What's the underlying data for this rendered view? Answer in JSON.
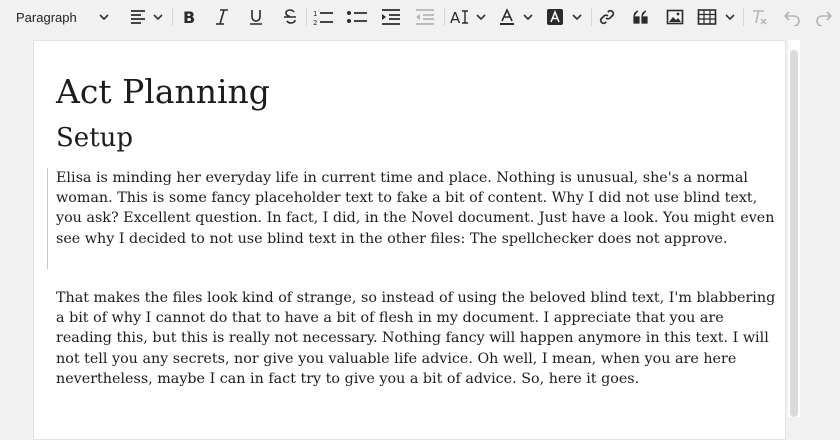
{
  "toolbar": {
    "paragraph_style": "Paragraph",
    "buttons": [
      {
        "name": "align-icon"
      },
      {
        "name": "bold-icon"
      },
      {
        "name": "italic-icon"
      },
      {
        "name": "underline-icon"
      },
      {
        "name": "strikethrough-icon"
      },
      {
        "name": "numbered-list-icon"
      },
      {
        "name": "bulleted-list-icon"
      },
      {
        "name": "indent-icon"
      },
      {
        "name": "outdent-icon"
      },
      {
        "name": "font-size-icon"
      },
      {
        "name": "font-color-icon"
      },
      {
        "name": "highlight-icon"
      },
      {
        "name": "link-icon"
      },
      {
        "name": "blockquote-icon"
      },
      {
        "name": "image-icon"
      },
      {
        "name": "table-icon"
      },
      {
        "name": "clear-format-icon"
      },
      {
        "name": "undo-icon"
      },
      {
        "name": "redo-icon"
      }
    ]
  },
  "document": {
    "title": "Act Planning",
    "heading": "Setup",
    "paragraphs": [
      "Elisa is minding her everyday life in current time and place. Nothing is unusual, she's a normal woman. This is some fancy placeholder text to fake a bit of content. Why I did not use blind text, you ask? Excellent question. In fact, I did, in the Novel document. Just have a look. You might even see why I decided to not use blind text in the other files: The spellchecker does not approve.",
      "That makes the files look kind of strange, so instead of using the beloved blind text, I'm blabbering a bit of why I cannot do that to have a bit of flesh in my document. I appreciate that you are reading this, but this is really not necessary. Nothing fancy will happen anymore in this text. I will not tell you any secrets, nor give you valuable life advice. Oh well, I mean, when you are here nevertheless, maybe I can in fact try to give you a bit of advice. So, here it goes."
    ]
  }
}
